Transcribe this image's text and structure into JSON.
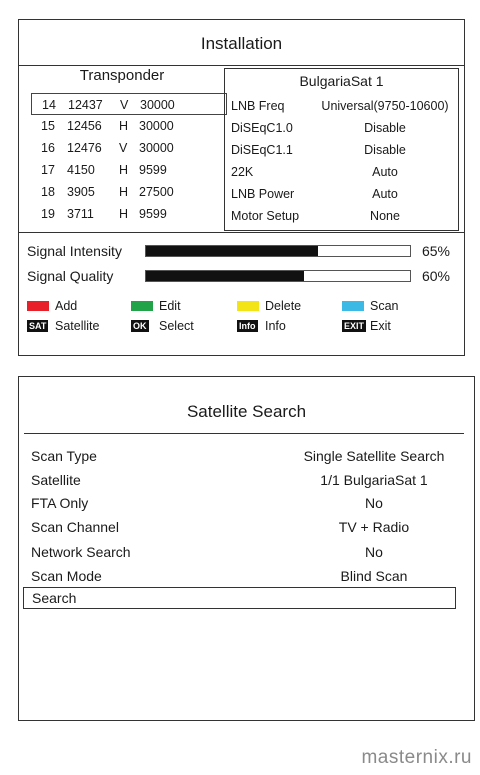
{
  "installation": {
    "title": "Installation",
    "transponder_header": "Transponder",
    "transponders": [
      {
        "no": "14",
        "freq": "12437",
        "pol": "V",
        "sym": "30000",
        "selected": true
      },
      {
        "no": "15",
        "freq": "12456",
        "pol": "H",
        "sym": "30000",
        "selected": false
      },
      {
        "no": "16",
        "freq": "12476",
        "pol": "V",
        "sym": "30000",
        "selected": false
      },
      {
        "no": "17",
        "freq": "4150",
        "pol": "H",
        "sym": "9599",
        "selected": false
      },
      {
        "no": "18",
        "freq": "3905",
        "pol": "H",
        "sym": "27500",
        "selected": false
      },
      {
        "no": "19",
        "freq": "3711",
        "pol": "H",
        "sym": "9599",
        "selected": false
      }
    ],
    "satellite_name": "BulgariaSat 1",
    "settings": [
      {
        "label": "LNB Freq",
        "value": "Universal(9750-10600)"
      },
      {
        "label": "DiSEqC1.0",
        "value": "Disable"
      },
      {
        "label": "DiSEqC1.1",
        "value": "Disable"
      },
      {
        "label": "22K",
        "value": "Auto"
      },
      {
        "label": "LNB Power",
        "value": "Auto"
      },
      {
        "label": "Motor Setup",
        "value": "None"
      }
    ],
    "signal_intensity": {
      "label": "Signal Intensity",
      "value": "65%",
      "fraction": 0.65
    },
    "signal_quality": {
      "label": "Signal Quality",
      "value": "60%",
      "fraction": 0.6
    },
    "legend": {
      "add": {
        "label": "Add",
        "color": "#e8202a"
      },
      "edit": {
        "label": "Edit",
        "color": "#22a34a"
      },
      "delete": {
        "label": "Delete",
        "color": "#f2e416"
      },
      "scan": {
        "label": "Scan",
        "color": "#3db9e6"
      },
      "satellite": {
        "key": "SAT",
        "label": "Satellite"
      },
      "select": {
        "key": "OK",
        "label": "Select"
      },
      "info": {
        "key": "Info",
        "label": "Info"
      },
      "exit": {
        "key": "EXIT",
        "label": "Exit"
      }
    }
  },
  "satellite_search": {
    "title": "Satellite Search",
    "rows": [
      {
        "label": "Scan Type",
        "value": "Single Satellite Search"
      },
      {
        "label": "Satellite",
        "value": "1/1 BulgariaSat 1"
      },
      {
        "label": "FTA Only",
        "value": "No"
      },
      {
        "label": "Scan Channel",
        "value": "TV + Radio"
      },
      {
        "label": "Network Search",
        "value": "No"
      },
      {
        "label": "Scan Mode",
        "value": "Blind Scan"
      }
    ],
    "search_label": "Search"
  },
  "watermark": "masternix.ru"
}
